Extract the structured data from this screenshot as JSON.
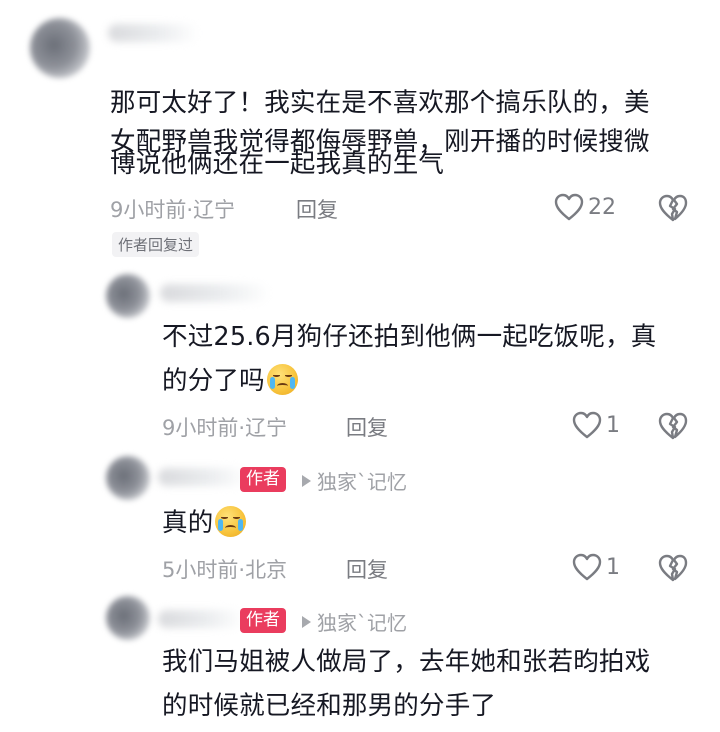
{
  "comments": [
    {
      "text_lines": [
        "那可太好了！我实在是不喜欢那个搞乐队的，美",
        "女配野兽我觉得都侮辱野兽，刚开播的时候搜微",
        "博说他俩还在一起我真的生气"
      ],
      "time": "9小时前",
      "location": "辽宁",
      "reply_label": "回复",
      "likes": "22",
      "author_replied": "作者回复过"
    },
    {
      "text_lines": [
        "不过25.6月狗仔还拍到他俩一起吃饭呢，真",
        "的分了吗"
      ],
      "emoji": "crying-face",
      "time": "9小时前",
      "location": "辽宁",
      "reply_label": "回复",
      "likes": "1"
    },
    {
      "author_badge": "作者",
      "reply_to": "独家`记忆",
      "text_lines": [
        "真的"
      ],
      "emoji": "crying-face",
      "time": "5小时前",
      "location": "北京",
      "reply_label": "回复",
      "likes": "1"
    },
    {
      "author_badge": "作者",
      "reply_to": "独家`记忆",
      "text_lines": [
        "我们马姐被人做局了，去年她和张若昀拍戏",
        "的时候就已经和那男的分手了"
      ]
    }
  ],
  "separator": "·",
  "colors": {
    "author_badge_bg": "#ea3c5e",
    "meta_text": "#9fa1a6"
  }
}
